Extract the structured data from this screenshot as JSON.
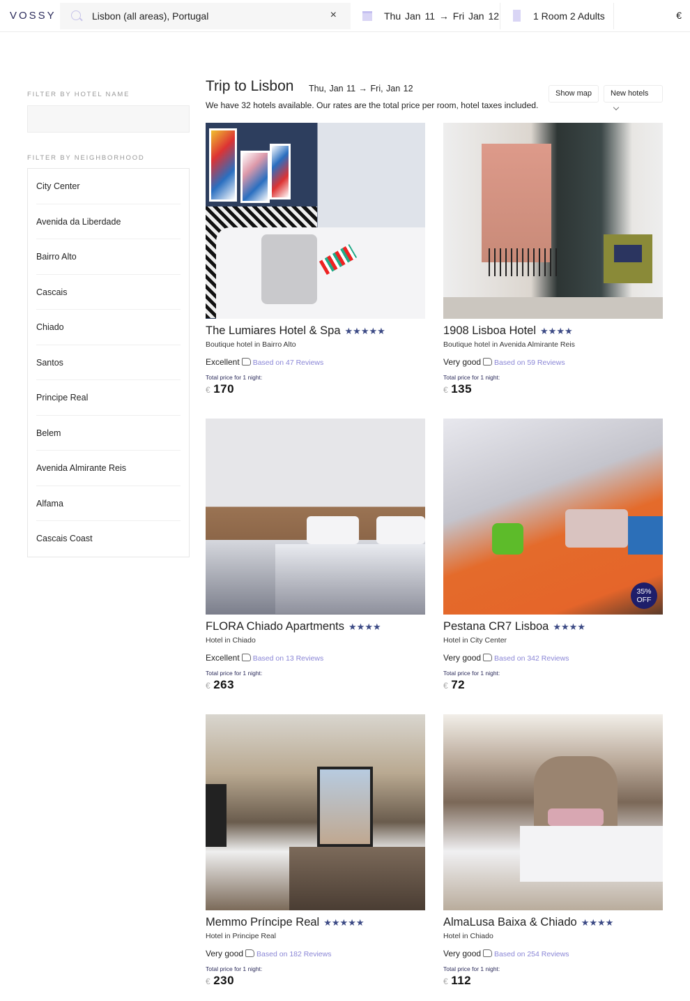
{
  "header": {
    "logo": "VOSSY",
    "search_value": "Lisbon (all areas), Portugal",
    "clear_label": "×",
    "dates": "Thu Jan 11  →  Fri Jan 12",
    "guests": "1 Room  2 Adults",
    "currency": "€"
  },
  "sidebar": {
    "hotel_name_label": "Filter by hotel name",
    "hotel_name_value": "",
    "neighborhood_label": "Filter by neighborhood",
    "neighborhoods": [
      "City Center",
      "Avenida da Liberdade",
      "Bairro Alto",
      "Cascais",
      "Chiado",
      "Santos",
      "Principe Real",
      "Belem",
      "Avenida Almirante Reis",
      "Alfama",
      "Cascais Coast"
    ]
  },
  "main": {
    "title": "Trip to Lisbon",
    "dates": "Thu, Jan 11  →  Fri, Jan 12",
    "subtitle": "We have 32 hotels available. Our rates are the total price per room, hotel taxes included.",
    "show_map_label": "Show map",
    "sort_label": "New hotels",
    "price_label": "Total price for 1 night:",
    "currency_symbol": "€",
    "hotels": [
      {
        "name": "The Lumiares Hotel & Spa",
        "stars": "★★★★★",
        "type": "Boutique hotel in Bairro Alto",
        "rating": "Excellent",
        "reviews": "Based on 47 Reviews",
        "price": "170",
        "badge": ""
      },
      {
        "name": "1908 Lisboa Hotel",
        "stars": "★★★★",
        "type": "Boutique hotel in Avenida Almirante Reis",
        "rating": "Very good",
        "reviews": "Based on 59 Reviews",
        "price": "135",
        "badge": ""
      },
      {
        "name": "FLORA Chiado Apartments",
        "stars": "★★★★",
        "type": "Hotel in Chiado",
        "rating": "Excellent",
        "reviews": "Based on 13 Reviews",
        "price": "263",
        "badge": ""
      },
      {
        "name": "Pestana CR7 Lisboa",
        "stars": "★★★★",
        "type": "Hotel in City Center",
        "rating": "Very good",
        "reviews": "Based on 342 Reviews",
        "price": "72",
        "badge": "35% OFF"
      },
      {
        "name": "Memmo Príncipe Real",
        "stars": "★★★★★",
        "type": "Hotel in Principe Real",
        "rating": "Very good",
        "reviews": "Based on 182 Reviews",
        "price": "230",
        "badge": ""
      },
      {
        "name": "AlmaLusa Baixa & Chiado",
        "stars": "★★★★",
        "type": "Hotel in Chiado",
        "rating": "Very good",
        "reviews": "Based on 254 Reviews",
        "price": "112",
        "badge": ""
      }
    ]
  }
}
